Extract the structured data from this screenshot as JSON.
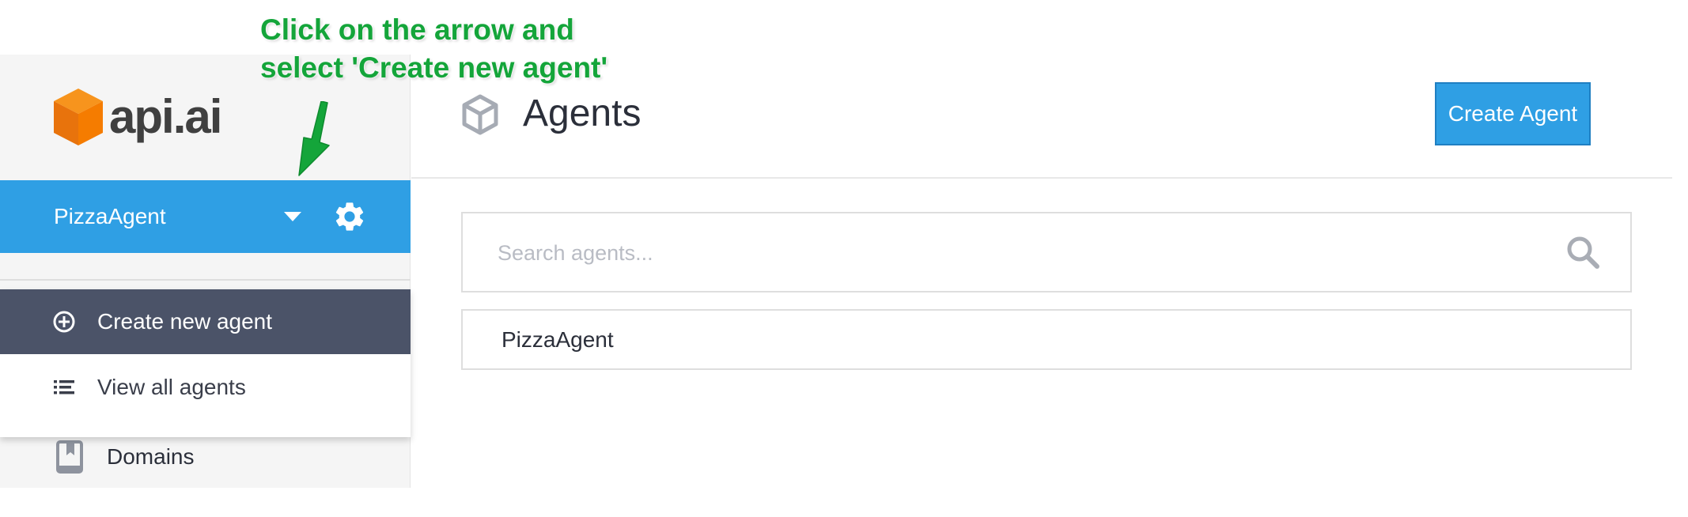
{
  "annotation": {
    "line1": "Click on the arrow and",
    "line2": "select 'Create new agent'"
  },
  "logo": {
    "text": "api.ai",
    "mark_icon": "api-ai-cube-icon",
    "color": "#f57c00"
  },
  "sidebar": {
    "current_agent": "PizzaAgent",
    "dropdown_icon": "chevron-down-icon",
    "settings_icon": "gear-icon",
    "dropdown": {
      "items": [
        {
          "label": "Create new agent",
          "icon": "plus-circle-icon",
          "active": true
        },
        {
          "label": "View all agents",
          "icon": "list-icon",
          "active": false
        }
      ]
    },
    "domains": {
      "label": "Domains",
      "icon": "book-icon"
    }
  },
  "header": {
    "title": "Agents",
    "icon": "cube-icon",
    "create_button": "Create Agent"
  },
  "search": {
    "placeholder": "Search agents...",
    "value": ""
  },
  "agents": [
    {
      "name": "PizzaAgent"
    }
  ],
  "colors": {
    "accent_blue": "#2f9fe4",
    "dropdown_active": "#4b5368",
    "annotation_green": "#14a53a",
    "logo_orange": "#f57c00"
  }
}
